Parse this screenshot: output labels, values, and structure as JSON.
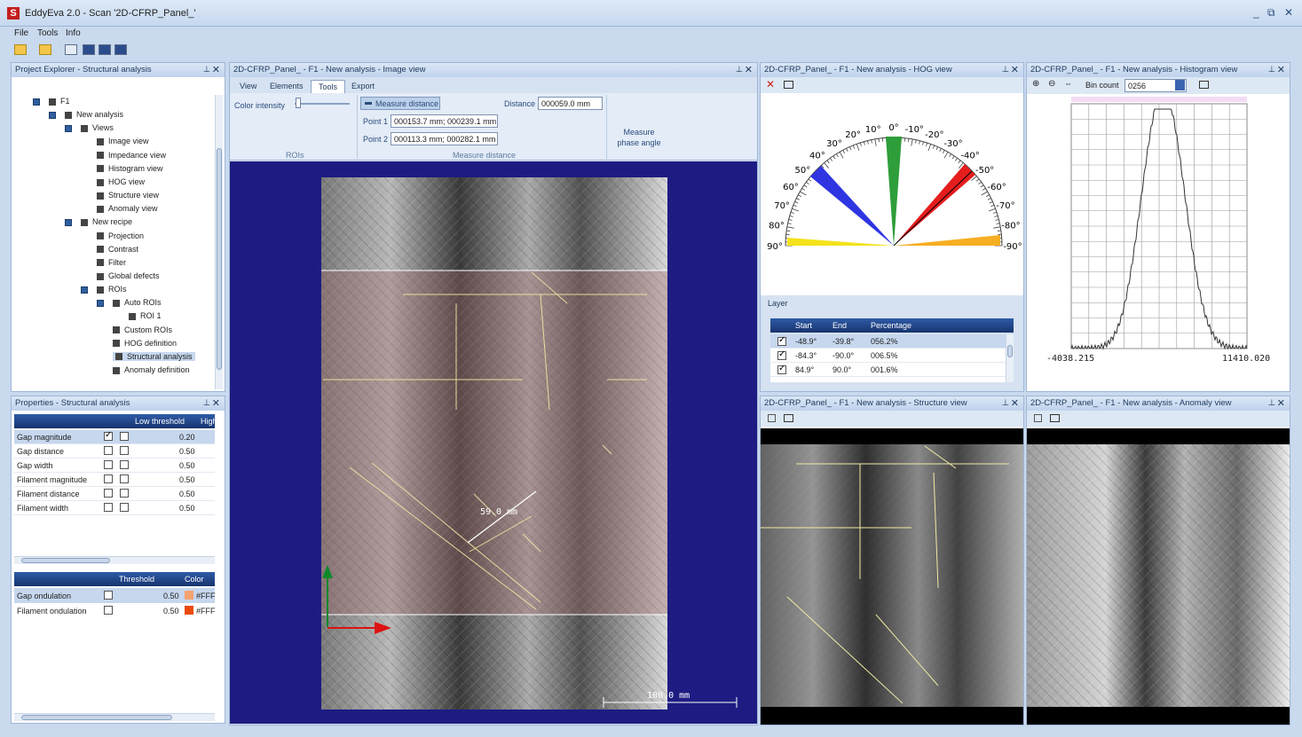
{
  "window": {
    "title": "EddyEva 2.0 - Scan '2D-CFRP_Panel_'",
    "minimize": "_",
    "restore": "⧉",
    "close": "✕"
  },
  "menu": [
    "File",
    "Tools",
    "Info"
  ],
  "panes": {
    "project_explorer": {
      "title": "Project Explorer - Structural analysis"
    },
    "properties": {
      "title": "Properties - Structural analysis"
    },
    "image_view": {
      "title": "2D-CFRP_Panel_ - F1 - New analysis - Image view"
    },
    "hog_view": {
      "title": "2D-CFRP_Panel_ - F1 - New analysis - HOG view"
    },
    "histogram_view": {
      "title": "2D-CFRP_Panel_ - F1 - New analysis - Histogram view"
    },
    "structure_view": {
      "title": "2D-CFRP_Panel_ - F1 - New analysis - Structure view"
    },
    "anomaly_view": {
      "title": "2D-CFRP_Panel_ - F1 - New analysis - Anomaly view"
    }
  },
  "tree": [
    {
      "label": "F1",
      "level": 0
    },
    {
      "label": "New analysis",
      "level": 1
    },
    {
      "label": "Views",
      "level": 2
    },
    {
      "label": "Image view",
      "level": 3
    },
    {
      "label": "Impedance view",
      "level": 3
    },
    {
      "label": "Histogram view",
      "level": 3
    },
    {
      "label": "HOG view",
      "level": 3
    },
    {
      "label": "Structure view",
      "level": 3
    },
    {
      "label": "Anomaly view",
      "level": 3
    },
    {
      "label": "New recipe",
      "level": 2
    },
    {
      "label": "Projection",
      "level": 3
    },
    {
      "label": "Contrast",
      "level": 3
    },
    {
      "label": "Filter",
      "level": 3
    },
    {
      "label": "Global defects",
      "level": 3
    },
    {
      "label": "ROIs",
      "level": 3
    },
    {
      "label": "Auto ROIs",
      "level": 4
    },
    {
      "label": "ROI 1",
      "level": 5
    },
    {
      "label": "Custom ROIs",
      "level": 4
    },
    {
      "label": "HOG definition",
      "level": 4
    },
    {
      "label": "Structural analysis",
      "level": 4,
      "selected": true
    },
    {
      "label": "Anomaly definition",
      "level": 4
    }
  ],
  "properties": {
    "headers": {
      "low": "Low threshold",
      "high": "High"
    },
    "rows": [
      {
        "name": "Gap magnitude",
        "c1": true,
        "c2": false,
        "low": "0.20"
      },
      {
        "name": "Gap distance",
        "c1": false,
        "c2": false,
        "low": "0.50"
      },
      {
        "name": "Gap width",
        "c1": false,
        "c2": false,
        "low": "0.50"
      },
      {
        "name": "Filament magnitude",
        "c1": false,
        "c2": false,
        "low": "0.50"
      },
      {
        "name": "Filament distance",
        "c1": false,
        "c2": false,
        "low": "0.50"
      },
      {
        "name": "Filament width",
        "c1": false,
        "c2": false,
        "low": "0.50"
      }
    ],
    "headers2": {
      "threshold": "Threshold",
      "color": "Color"
    },
    "rows2": [
      {
        "name": "Gap ondulation",
        "value": "0.50",
        "color_hex": "#f5a271",
        "color": "#FFF"
      },
      {
        "name": "Filament ondulation",
        "value": "0.50",
        "color_hex": "#e94a0c",
        "color": "#FFF"
      }
    ]
  },
  "image_view": {
    "tabs": [
      "View",
      "Elements",
      "Tools",
      "Export"
    ],
    "active_tab": "Tools",
    "color_intensity": "Color intensity",
    "measure_distance_btn": "Measure distance",
    "distance_label": "Distance",
    "distance_value": "000059.0 mm",
    "point1_label": "Point 1",
    "point1_value": "000153.7 mm; 000239.1 mm",
    "point2_label": "Point 2",
    "point2_value": "000113.3 mm; 000282.1 mm",
    "measure_phase": "Measure phase angle",
    "group_rois": "ROIs",
    "group_measure": "Measure distance",
    "measure_label": "59.0 mm",
    "scale_label": "100.0 mm"
  },
  "hog": {
    "angles": [
      "0°",
      "10°",
      "20°",
      "30°",
      "40°",
      "50°",
      "60°",
      "70°",
      "80°",
      "90°",
      "-10°",
      "-20°",
      "-30°",
      "-40°",
      "-50°",
      "-60°",
      "-70°",
      "-80°",
      "-90°"
    ],
    "colors": {
      "green": "#2e9e3a",
      "blue": "#2f35e0",
      "red": "#e51d1d",
      "yellow": "#f4e21b",
      "orange": "#f6ae22"
    },
    "layer_title": "Layer",
    "columns": [
      "Start",
      "End",
      "Percentage"
    ],
    "rows": [
      {
        "start": "-48.9°",
        "end": "-39.8°",
        "pct": "056.2%",
        "checked": true
      },
      {
        "start": "-84.3°",
        "end": "-90.0°",
        "pct": "006.5%",
        "checked": true
      },
      {
        "start": "84.9°",
        "end": "90.0°",
        "pct": "001.6%",
        "checked": true
      }
    ]
  },
  "histogram": {
    "bin_count_label": "Bin count",
    "bin_count": "0256",
    "xmin": "-4038.215",
    "xmax": "11410.020"
  }
}
